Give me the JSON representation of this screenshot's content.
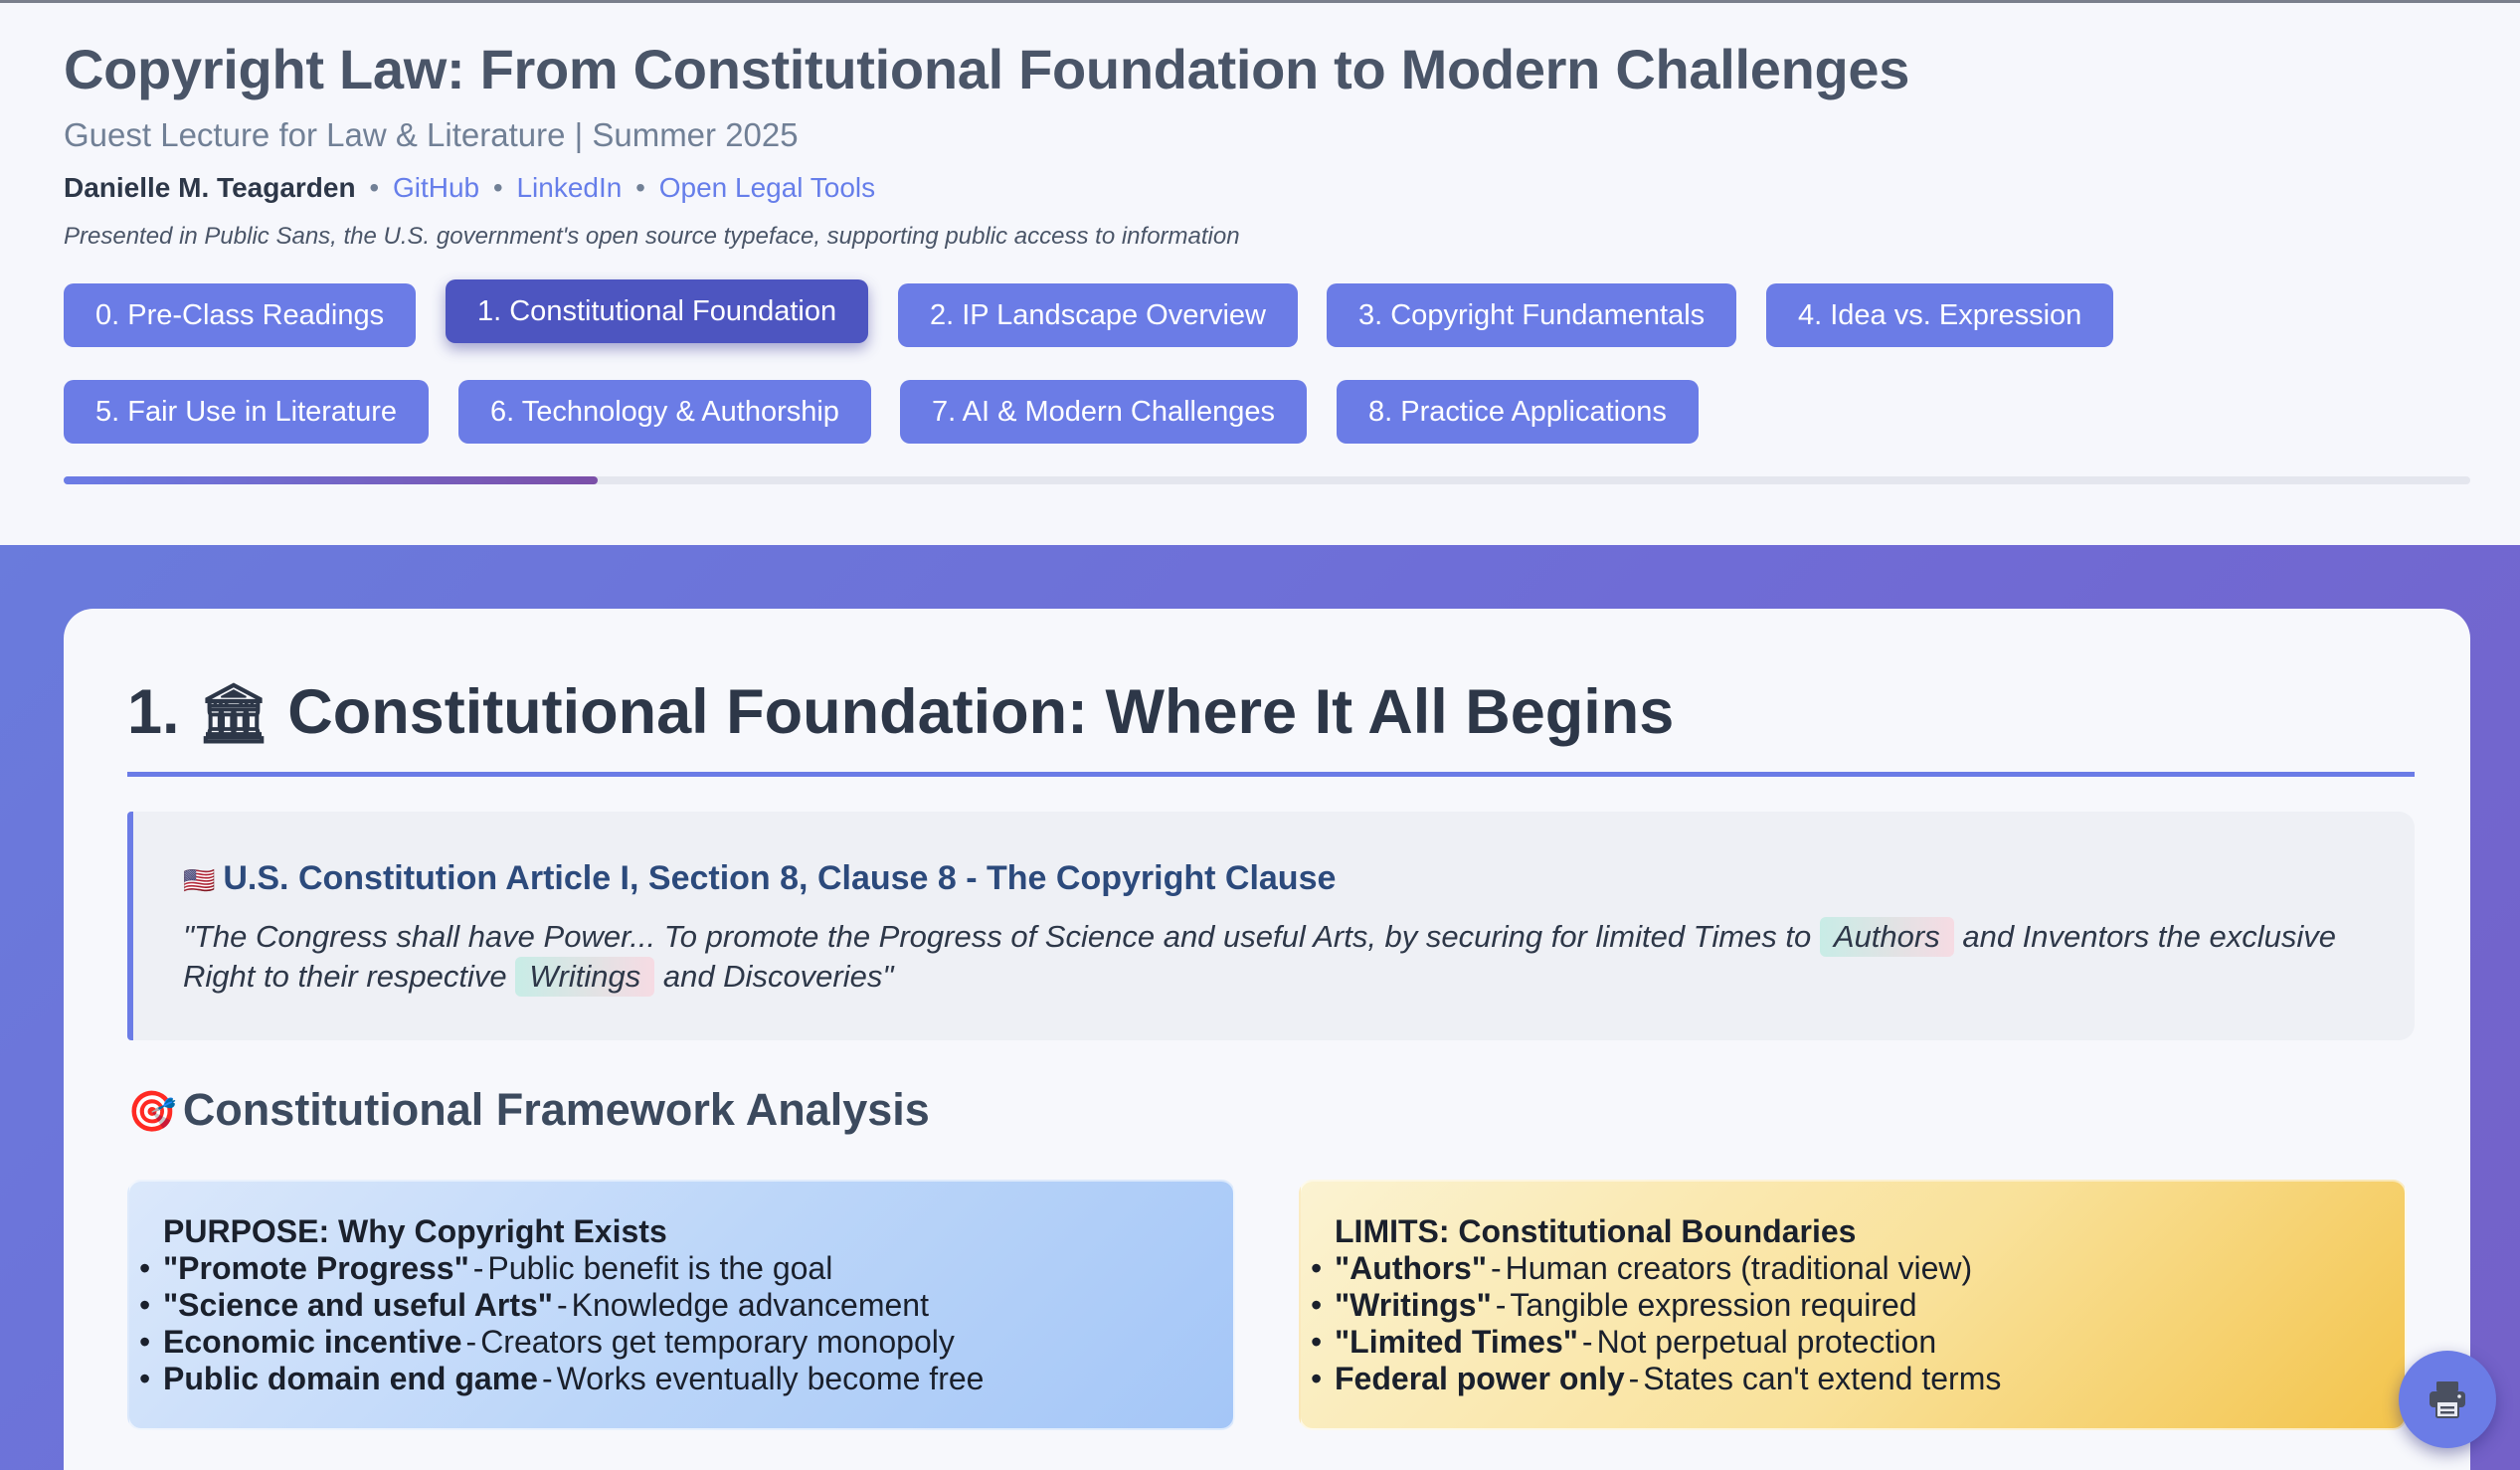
{
  "header": {
    "title": "Copyright Law: From Constitutional Foundation to Modern Challenges",
    "subtitle": "Guest Lecture for Law & Literature | Summer 2025",
    "author": "Danielle M. Teagarden",
    "separator": "•",
    "links": [
      "GitHub",
      "LinkedIn",
      "Open Legal Tools"
    ],
    "note": "Presented in Public Sans, the U.S. government's open source typeface, supporting public access to information"
  },
  "nav": {
    "tabs": [
      "0. Pre-Class Readings",
      "1. Constitutional Foundation",
      "2. IP Landscape Overview",
      "3. Copyright Fundamentals",
      "4. Idea vs. Expression",
      "5. Fair Use in Literature",
      "6. Technology & Authorship",
      "7. AI & Modern Challenges",
      "8. Practice Applications"
    ],
    "active_index": 1,
    "progress": 0.222
  },
  "section": {
    "number": "1.",
    "emoji": "🏛",
    "title": "Constitutional Foundation: Where It All Begins",
    "quote": {
      "flag": "🇺🇸",
      "heading": "U.S. Constitution Article I, Section 8, Clause 8 - The Copyright Clause",
      "part1": "\"The Congress shall have Power... To promote the Progress of Science and useful Arts, by securing for limited Times to ",
      "highlight1": "Authors",
      "part2": " and Inventors the exclusive Right to their respective ",
      "highlight2": "Writings",
      "part3": " and Discoveries\""
    },
    "framework": {
      "emoji": "🎯",
      "title": "Constitutional Framework Analysis",
      "purpose": {
        "title": "PURPOSE: Why Copyright Exists",
        "items": [
          {
            "term": "\"Promote Progress\"",
            "desc": "Public benefit is the goal"
          },
          {
            "term": "\"Science and useful Arts\"",
            "desc": "Knowledge advancement"
          },
          {
            "term": "Economic incentive",
            "desc": "Creators get temporary monopoly"
          },
          {
            "term": "Public domain end game",
            "desc": "Works eventually become free"
          }
        ]
      },
      "limits": {
        "title": "LIMITS: Constitutional Boundaries",
        "items": [
          {
            "term": "\"Authors\"",
            "desc": "Human creators (traditional view)"
          },
          {
            "term": "\"Writings\"",
            "desc": "Tangible expression required"
          },
          {
            "term": "\"Limited Times\"",
            "desc": "Not perpetual protection"
          },
          {
            "term": "Federal power only",
            "desc": "States can't extend terms"
          }
        ]
      }
    }
  },
  "print_button": {
    "icon": "printer-icon"
  },
  "colors": {
    "accent": "#6b7ce6",
    "active_tab": "#4d55c0",
    "heading": "#2d3748",
    "quote_heading": "#2c4a7c"
  }
}
